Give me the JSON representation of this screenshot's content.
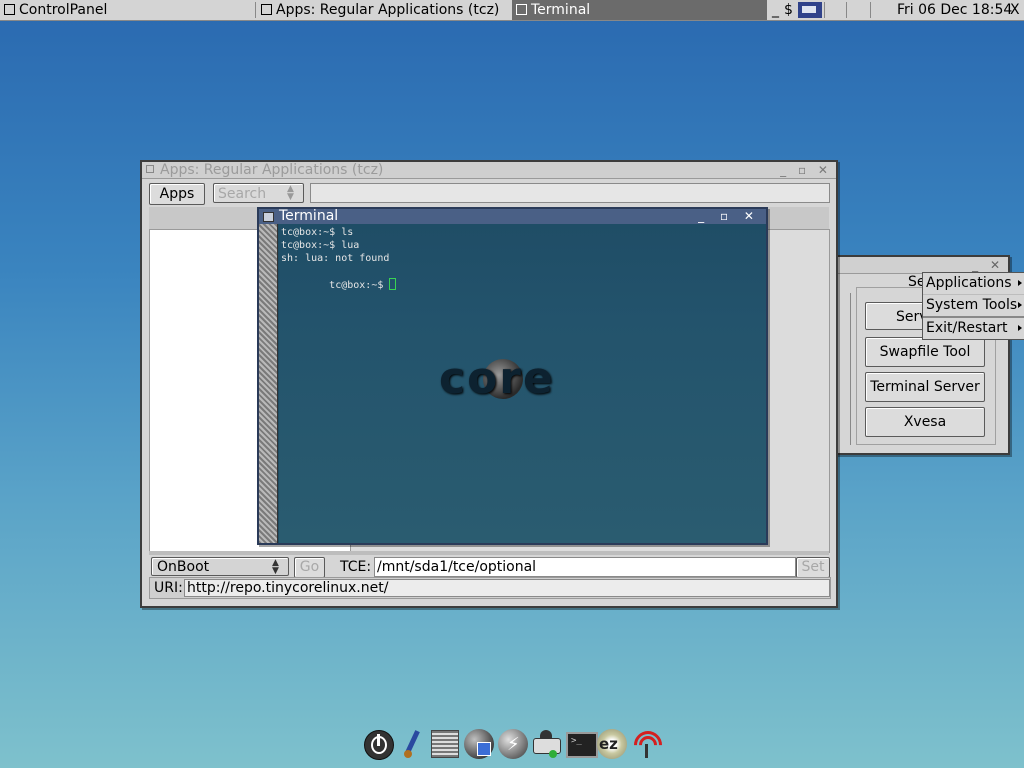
{
  "topbar": {
    "tasks": [
      {
        "label": "ControlPanel"
      },
      {
        "label": "Apps: Regular Applications (tcz)"
      },
      {
        "label": "Terminal"
      }
    ],
    "tray_dollar": "$",
    "tray_underscore": "_",
    "clock": "Fri 06 Dec 18:54",
    "close": "X"
  },
  "apps_window": {
    "title": "Apps: Regular Applications (tcz)",
    "apps_button": "Apps",
    "search_placeholder": "Search",
    "onboot_select": "OnBoot",
    "go_button": "Go",
    "tce_label": "TCE:",
    "tce_value": "/mnt/sda1/tce/optional",
    "set_button": "Set",
    "uri_label": "URI:",
    "uri_value": "http://repo.tinycorelinux.net/"
  },
  "terminal": {
    "title": "Terminal",
    "lines": [
      "tc@box:~$ ls",
      "tc@box:~$ lua",
      "sh: lua: not found",
      "tc@box:~$ "
    ],
    "logo_text": "core",
    "colors": {
      "bg": "#1f4d66",
      "title_bg": "#4a6086",
      "cursor": "#39d353"
    }
  },
  "control_panel": {
    "menu_partial": "Se",
    "serv_partial": "Serv",
    "buttons": [
      "Swapfile Tool",
      "Terminal Server",
      "Xvesa"
    ]
  },
  "context_menu": {
    "items": [
      "Applications",
      "System Tools",
      "Exit/Restart"
    ]
  },
  "dock": {
    "icons": [
      "power-icon",
      "paintbrush-icon",
      "editor-icon",
      "apps-icon",
      "running-icon",
      "mount-icon",
      "terminal-icon",
      "ezremaster-icon",
      "wireless-icon"
    ],
    "ez_text": "ez"
  }
}
